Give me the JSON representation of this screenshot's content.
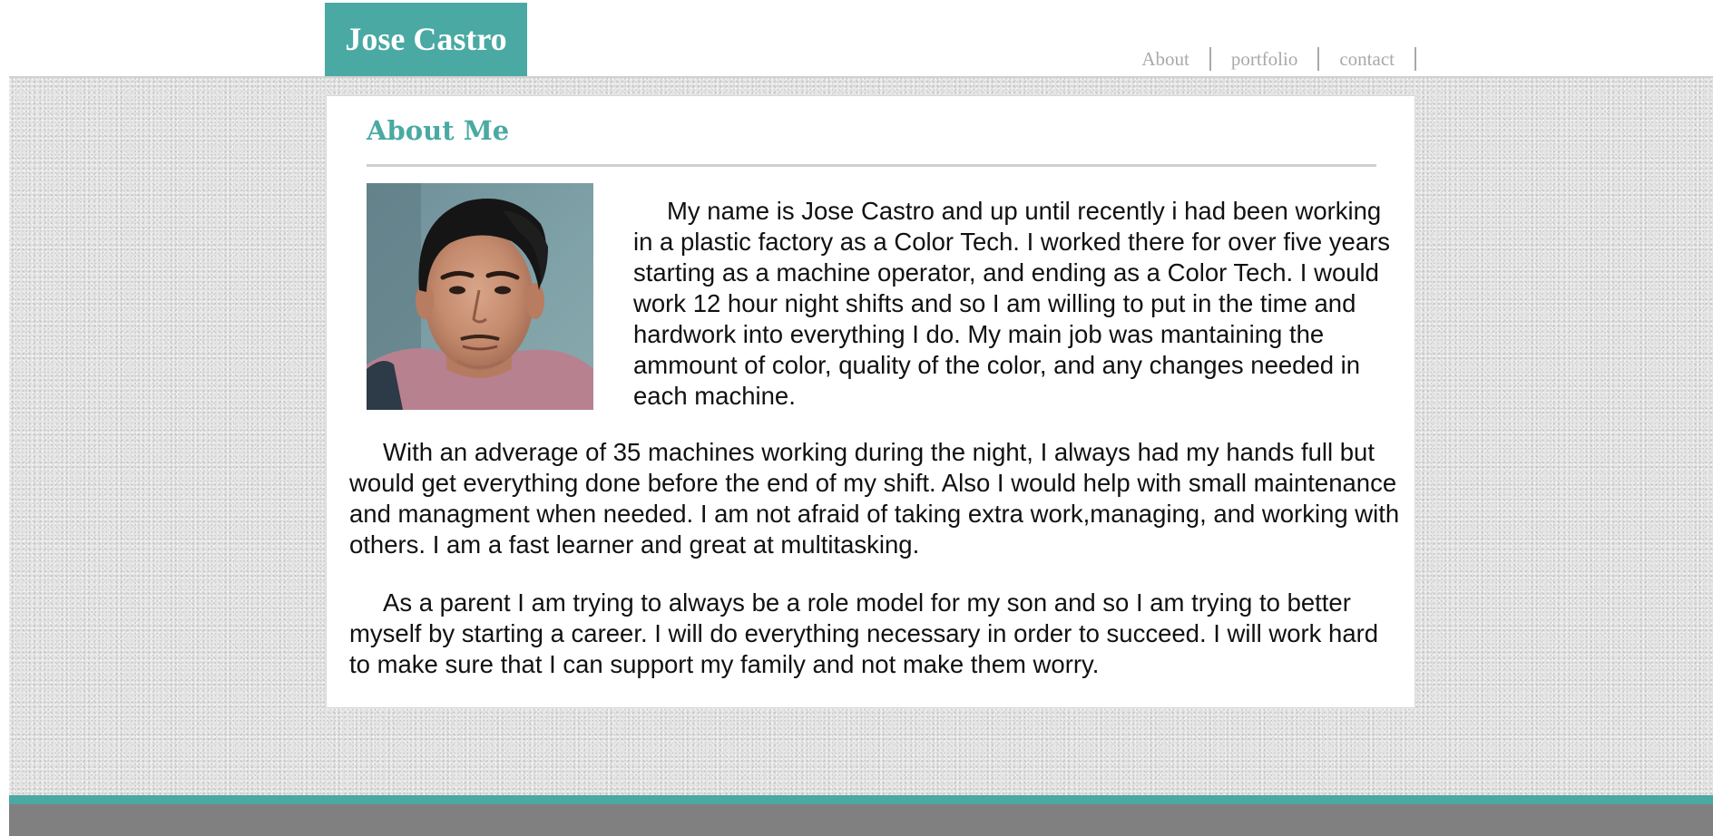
{
  "site": {
    "brand_name": "Jose Castro",
    "accent_color": "#4aa9a3"
  },
  "nav": {
    "items": [
      {
        "label": "About"
      },
      {
        "label": "portfolio"
      },
      {
        "label": "contact"
      }
    ]
  },
  "about": {
    "heading": "About Me",
    "photo_icon": "profile-photo",
    "paragraphs": [
      "My name is Jose Castro and up until recently i had been working in a plastic factory as a Color Tech. I worked there for over five years starting as a machine operator, and ending as a Color Tech. I would work 12 hour night shifts and so I am willing to put in the time and hardwork into everything I do. My main job was mantaining the ammount of color, quality of the color, and any changes needed in each machine.",
      "With an adverage of 35 machines working during the night, I always had my hands full but would get everything done before the end of my shift. Also I would help with small maintenance and managment when needed. I am not afraid of taking extra work,managing, and working with others. I am a fast learner and great at multitasking.",
      "As a parent I am trying to always be a role model for my son and so I am trying to better myself by starting a career. I will do everything necessary in order to succeed. I will work hard to make sure that I can support my family and not make them worry."
    ]
  }
}
